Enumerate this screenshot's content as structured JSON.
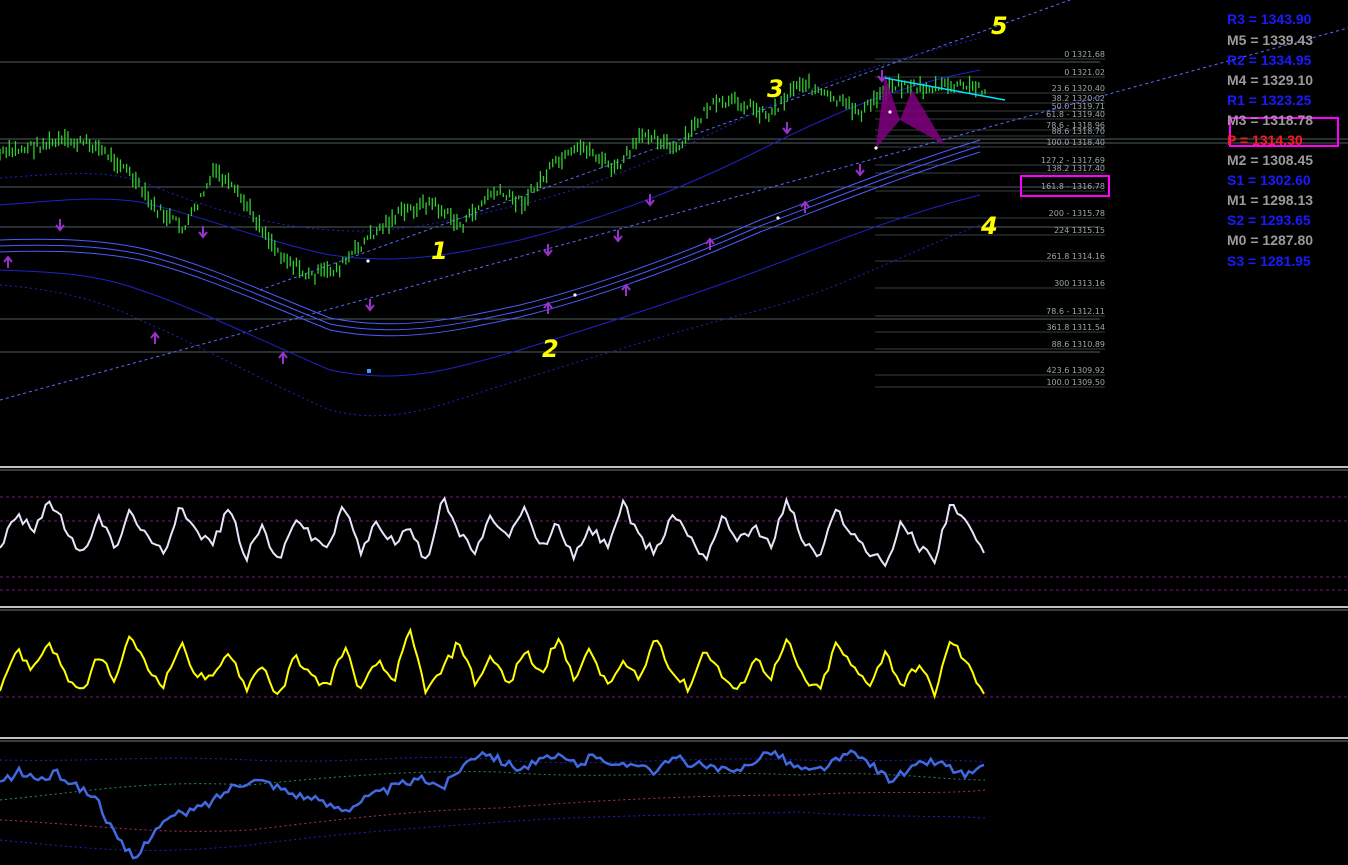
{
  "chart_data": [
    {
      "type": "line",
      "title": "",
      "xlabel": "",
      "ylabel": "",
      "ylim": [
        1309.5,
        1321.7
      ],
      "series": [
        {
          "values": [
            1318.2,
            1318.5,
            1318.7,
            1318.6,
            1317.8,
            1316.2,
            1315.4,
            1317.6,
            1316.3,
            1314.6,
            1313.6,
            1313.9,
            1315.1,
            1316.0,
            1316.4,
            1315.5,
            1316.8,
            1316.4,
            1317.8,
            1318.5,
            1317.6,
            1319.1,
            1318.3,
            1320.0,
            1320.2,
            1319.7,
            1321.0,
            1320.3,
            1319.8,
            1320.9,
            1320.7,
            1320.8,
            1320.7
          ]
        }
      ],
      "overlays": [
        "upward channel",
        "envelope bands",
        "fibonacci levels",
        "harmonic pattern"
      ]
    },
    {
      "type": "line",
      "ylim": [
        0,
        100
      ],
      "series": [
        {
          "color": "#e6e6fa",
          "values": [
            45,
            70,
            58,
            82,
            60,
            35,
            72,
            42,
            75,
            50,
            40,
            80,
            55,
            48,
            77,
            35,
            62,
            30,
            70,
            52,
            45,
            78,
            40,
            65,
            48,
            60,
            30,
            88,
            55,
            40,
            70,
            50,
            75,
            42,
            64,
            35,
            60,
            45,
            80,
            50,
            40,
            72,
            55,
            35,
            68,
            52,
            60,
            45,
            84,
            48,
            37,
            75,
            55,
            40,
            30,
            65,
            45,
            35,
            82,
            60,
            40
          ]
        }
      ],
      "levels": [
        80,
        70,
        30,
        20
      ]
    },
    {
      "type": "line",
      "ylim": [
        0,
        100
      ],
      "series": [
        {
          "color": "#ffff00",
          "values": [
            40,
            72,
            55,
            80,
            50,
            32,
            68,
            45,
            85,
            55,
            42,
            78,
            50,
            46,
            72,
            38,
            60,
            28,
            68,
            48,
            40,
            75,
            36,
            62,
            45,
            88,
            35,
            55,
            80,
            42,
            68,
            40,
            72,
            50,
            82,
            48,
            72,
            40,
            60,
            45,
            85,
            52,
            38,
            74,
            50,
            34,
            66,
            48,
            80,
            46,
            36,
            78,
            56,
            42,
            70,
            40,
            60,
            34,
            82,
            58,
            36
          ]
        }
      ],
      "levels": [
        50
      ]
    },
    {
      "type": "line",
      "series": [
        {
          "color": "#4169e1",
          "values": [
            60,
            66,
            62,
            65,
            58,
            52,
            30,
            18,
            35,
            42,
            45,
            50,
            58,
            62,
            60,
            55,
            52,
            48,
            46,
            52,
            56,
            60,
            62,
            58,
            70,
            78,
            72,
            68,
            72,
            74,
            70,
            76,
            68,
            72,
            66,
            74,
            70,
            68,
            65,
            72,
            78,
            70,
            66,
            70,
            76,
            72,
            62,
            66,
            72,
            70,
            64,
            68
          ]
        }
      ]
    }
  ],
  "wave_labels": [
    {
      "key": "w1",
      "text": "1"
    },
    {
      "key": "w2",
      "text": "2"
    },
    {
      "key": "w3",
      "text": "3"
    },
    {
      "key": "w4",
      "text": "4"
    },
    {
      "key": "w5",
      "text": "5"
    }
  ],
  "fib_labels": [
    "0 1321.68",
    "0 1321.02",
    "23.6 1320.40",
    "38.2 1320.02",
    "50.0 1319.71",
    "61.8 - 1319.40",
    "78.6 - 1318.96",
    "88.6 1318.70",
    "100.0 1318.40",
    "127.2 - 1317.69",
    "138.2 1317.40",
    "161.8 - 1316.78",
    "200 - 1315.78",
    "224 1315.15",
    "261.8 1314.16",
    "300 1313.16",
    "78.6 - 1312.11",
    "361.8 1311.54",
    "88.6 1310.89",
    "423.6 1309.92",
    "100.0 1309.50"
  ],
  "pivots": [
    {
      "label": "R3 = 1343.90",
      "color": "#1a1aff"
    },
    {
      "label": "M5 = 1339.43",
      "color": "#9a9a9a"
    },
    {
      "label": "R2 = 1334.95",
      "color": "#1a1aff"
    },
    {
      "label": "M4 = 1329.10",
      "color": "#9a9a9a"
    },
    {
      "label": "R1 = 1323.25",
      "color": "#1a1aff"
    },
    {
      "label": "M3 = 1318.78",
      "color": "#9a9a9a"
    },
    {
      "label": "P = 1314.30",
      "color": "#ff1a1a"
    },
    {
      "label": "M2 = 1308.45",
      "color": "#9a9a9a"
    },
    {
      "label": "S1 = 1302.60",
      "color": "#1a1aff"
    },
    {
      "label": "M1 = 1298.13",
      "color": "#9a9a9a"
    },
    {
      "label": "S2 = 1293.65",
      "color": "#1a1aff"
    },
    {
      "label": "M0 = 1287.80",
      "color": "#9a9a9a"
    },
    {
      "label": "S3 = 1281.95",
      "color": "#1a1aff"
    }
  ],
  "colors": {
    "background": "#000000",
    "price": "#32cd32",
    "bands": "#2020c8",
    "channel": "#5a6cff",
    "arrows": "#9932cc",
    "pattern": "#800080",
    "trendline": "#00e5ff",
    "highlight_box": "#ff00ff",
    "separator": "#ffffff"
  }
}
